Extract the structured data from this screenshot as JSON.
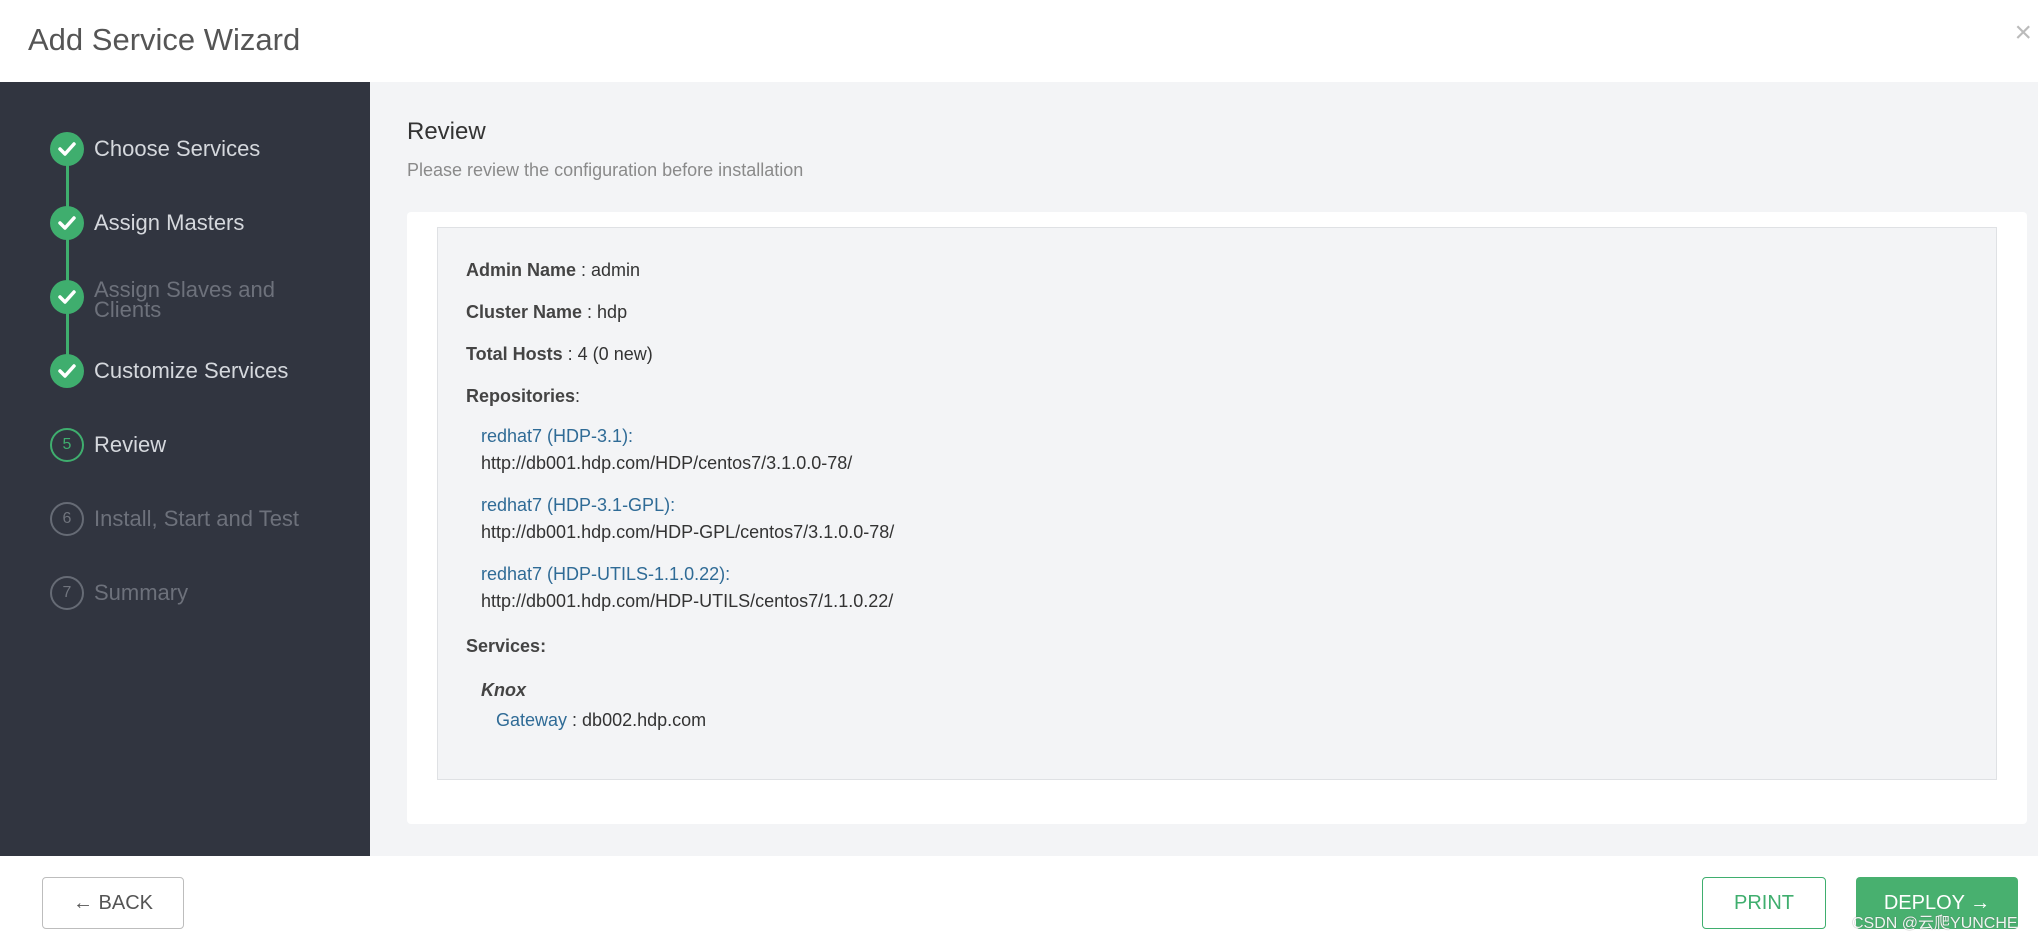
{
  "header": {
    "title": "Add Service Wizard",
    "close_label": "×"
  },
  "steps": [
    {
      "label": "Choose Services",
      "number": "",
      "state": "done"
    },
    {
      "label": "Assign Masters",
      "number": "",
      "state": "done"
    },
    {
      "label": "Assign Slaves and Clients",
      "number": "",
      "state": "done-disabled"
    },
    {
      "label": "Customize Services",
      "number": "",
      "state": "done"
    },
    {
      "label": "Review",
      "number": "5",
      "state": "current"
    },
    {
      "label": "Install, Start and Test",
      "number": "6",
      "state": "future"
    },
    {
      "label": "Summary",
      "number": "7",
      "state": "future"
    }
  ],
  "review": {
    "title": "Review",
    "subtitle": "Please review the configuration before installation",
    "admin_label": "Admin Name",
    "admin_value": " : admin",
    "cluster_label": "Cluster Name",
    "cluster_value": " : hdp",
    "hosts_label": "Total Hosts",
    "hosts_value": " : 4 (0 new)",
    "repos_label": "Repositories",
    "repos_suffix": ":",
    "repos": [
      {
        "name": "redhat7 (HDP-3.1):",
        "url": "http://db001.hdp.com/HDP/centos7/3.1.0.0-78/"
      },
      {
        "name": "redhat7 (HDP-3.1-GPL):",
        "url": "http://db001.hdp.com/HDP-GPL/centos7/3.1.0.0-78/"
      },
      {
        "name": "redhat7 (HDP-UTILS-1.1.0.22):",
        "url": "http://db001.hdp.com/HDP-UTILS/centos7/1.1.0.22/"
      }
    ],
    "services_label": "Services:",
    "service_name": "Knox",
    "component_name": "Gateway",
    "component_value": " : db002.hdp.com"
  },
  "footer": {
    "back_label": "← BACK",
    "print_label": "PRINT",
    "deploy_label": "DEPLOY →"
  },
  "watermark": "CSDN @云爬YUNCHE",
  "colors": {
    "accent": "#3fae6e",
    "sidebar": "#313540",
    "link": "#2f6b96"
  }
}
